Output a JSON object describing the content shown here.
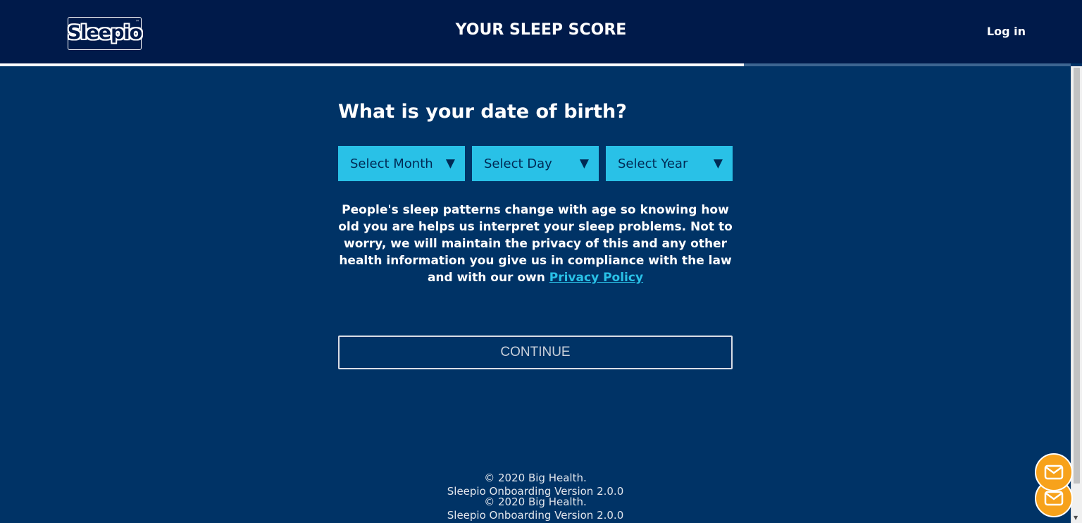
{
  "header": {
    "logo_text": "Sleepio",
    "title": "YOUR SLEEP SCORE",
    "login_label": "Log in"
  },
  "progress": {
    "fraction": 0.695
  },
  "form": {
    "question": "What is your date of birth?",
    "selects": [
      {
        "name": "month",
        "selected": "Select Month"
      },
      {
        "name": "day",
        "selected": "Select Day"
      },
      {
        "name": "year",
        "selected": "Select Year"
      }
    ],
    "info_text": "People's sleep patterns change with age so knowing how old you are helps us interpret your sleep problems. Not to worry, we will maintain the privacy of this and any other health information you give us in compliance with the law and with our own",
    "privacy_link": "Privacy Policy",
    "continue_label": "CONTINUE"
  },
  "footer": {
    "copyright": "© 2020 Big Health.",
    "version": "Sleepio Onboarding Version 2.0.0"
  },
  "icons": {
    "chat": "envelope-icon",
    "dropdown": "triangle-down-icon"
  },
  "colors": {
    "background": "#003366",
    "header": "#001a4a",
    "accent": "#29c1e7",
    "chat": "#f7a21b"
  }
}
